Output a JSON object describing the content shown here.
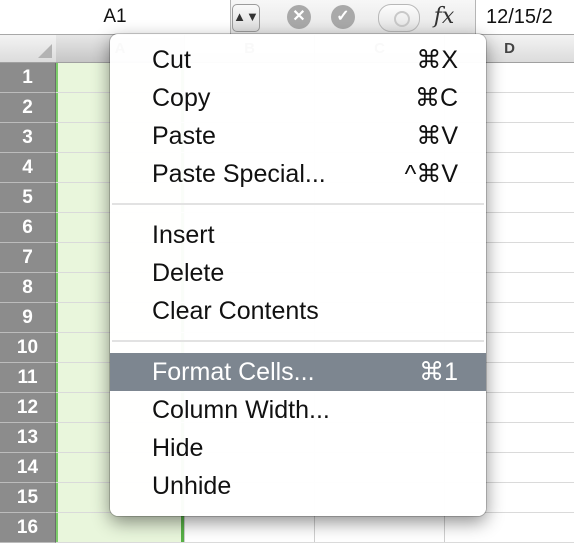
{
  "formula_bar": {
    "cell_ref": "A1",
    "stepper_glyph": "▲▼",
    "cancel_glyph": "✕",
    "confirm_glyph": "✓",
    "fx_label": "fx",
    "value": "12/15/2"
  },
  "grid": {
    "columns": [
      "A",
      "B",
      "C",
      "D"
    ],
    "rows": [
      "1",
      "2",
      "3",
      "4",
      "5",
      "6",
      "7",
      "8",
      "9",
      "10",
      "11",
      "12",
      "13",
      "14",
      "15",
      "16"
    ],
    "selected_column": "A",
    "selection_color": "#e9f6dc",
    "selection_border_color": "#57b146"
  },
  "context_menu": {
    "groups": [
      [
        {
          "label": "Cut",
          "shortcut": "⌘X"
        },
        {
          "label": "Copy",
          "shortcut": "⌘C"
        },
        {
          "label": "Paste",
          "shortcut": "⌘V"
        },
        {
          "label": "Paste Special...",
          "shortcut": "^⌘V"
        }
      ],
      [
        {
          "label": "Insert",
          "shortcut": ""
        },
        {
          "label": "Delete",
          "shortcut": ""
        },
        {
          "label": "Clear Contents",
          "shortcut": ""
        }
      ],
      [
        {
          "label": "Format Cells...",
          "shortcut": "⌘1",
          "highlighted": true
        },
        {
          "label": "Column Width...",
          "shortcut": ""
        },
        {
          "label": "Hide",
          "shortcut": ""
        },
        {
          "label": "Unhide",
          "shortcut": ""
        }
      ]
    ],
    "highlight_color": "#7d8690"
  }
}
